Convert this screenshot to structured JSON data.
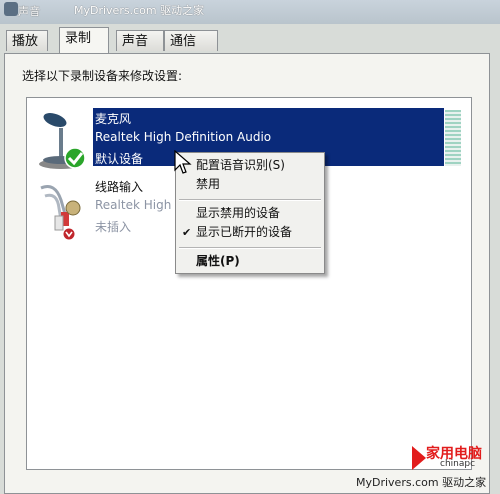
{
  "window": {
    "title": "声音"
  },
  "watermark": {
    "top": "MyDrivers.com 驱动之家",
    "bottom": "MyDrivers.com 驱动之家"
  },
  "tabs": [
    {
      "label": "播放"
    },
    {
      "label": "录制",
      "active": true
    },
    {
      "label": "声音"
    },
    {
      "label": "通信"
    }
  ],
  "instruction": "选择以下录制设备来修改设置:",
  "devices": [
    {
      "name": "麦克风",
      "driver": "Realtek High Definition Audio",
      "status": "默认设备",
      "icon": "microphone-icon",
      "badge": "green-check-icon",
      "selected": true
    },
    {
      "name": "线路输入",
      "driver": "Realtek High",
      "status": "未插入",
      "icon": "line-in-cable-icon",
      "badge": "red-down-arrow-icon",
      "selected": false
    }
  ],
  "context_menu": {
    "items": [
      {
        "label": "配置语音识别(S)"
      },
      {
        "label": "禁用"
      },
      {
        "label": "显示禁用的设备"
      },
      {
        "label": "显示已断开的设备",
        "checked": true
      },
      {
        "label": "属性(P)",
        "bold": true
      }
    ]
  },
  "branding": {
    "logo_text": "家用电脑",
    "sub": "chinapc"
  },
  "colors": {
    "selection": "#0a2a7a",
    "panel": "#f4f4f0",
    "brand": "#e21c1c"
  }
}
